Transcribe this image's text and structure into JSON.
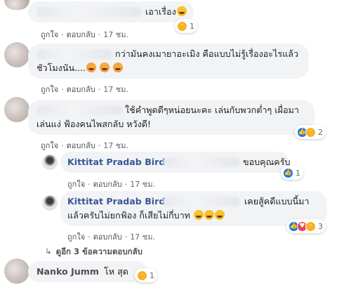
{
  "comments": [
    {
      "id": "c1",
      "author": "",
      "text": "เอาเรื่อง",
      "time": "17 ชม.",
      "reactions": {
        "icons": [
          "haha"
        ],
        "count": "1"
      }
    },
    {
      "id": "c2",
      "author": "",
      "lines": [
        "กว่ามันคงเมายาอะเมิง คือแบบไม่รู้เรื่องอะไรแล้ว",
        "ชัวโมงนัน...."
      ],
      "time": "17 ชม."
    },
    {
      "id": "c3",
      "author": "",
      "lines": [
        "ใช้คำพูดดีๆหน่อยนะคะ เล่นกับพวกต่ำๆ เผื่อมา",
        "เล่นแง่ ฟ้องคนไพสกลับ หวังดี!"
      ],
      "time": "17 ชม.",
      "reactions": {
        "icons": [
          "like",
          "haha"
        ],
        "count": "2"
      }
    },
    {
      "id": "r1",
      "author": "Kittitat Pradab Bird",
      "text": "ขอบคุณครับ",
      "time": "17 ชม.",
      "reactions": {
        "icons": [
          "like"
        ],
        "count": "1"
      }
    },
    {
      "id": "r2",
      "author": "Kittitat Pradab Bird",
      "lines": [
        "เคยสู้คดีแบบนี้มา",
        "แล้วครับไม่ยกฟ้อง ก็เสียไม่กี่บาท"
      ],
      "time": "17 ชม.",
      "reactions": {
        "icons": [
          "like",
          "love",
          "haha"
        ],
        "count": "3"
      }
    },
    {
      "id": "c4",
      "author": "Nanko Jumm",
      "text": "โห สุด",
      "reactions": {
        "icons": [
          "haha"
        ],
        "count": "1"
      }
    }
  ],
  "actions": {
    "like": "ถูกใจ",
    "reply": "ตอบกลับ",
    "separator": "·"
  },
  "view_more_replies": "ดูอีก 3 ข้อความตอบกลับ",
  "colors": {
    "bubble": "#f2f3f5",
    "author": "#385898",
    "like": "#1877f2",
    "haha": "#f7b125",
    "love": "#f33e58"
  }
}
